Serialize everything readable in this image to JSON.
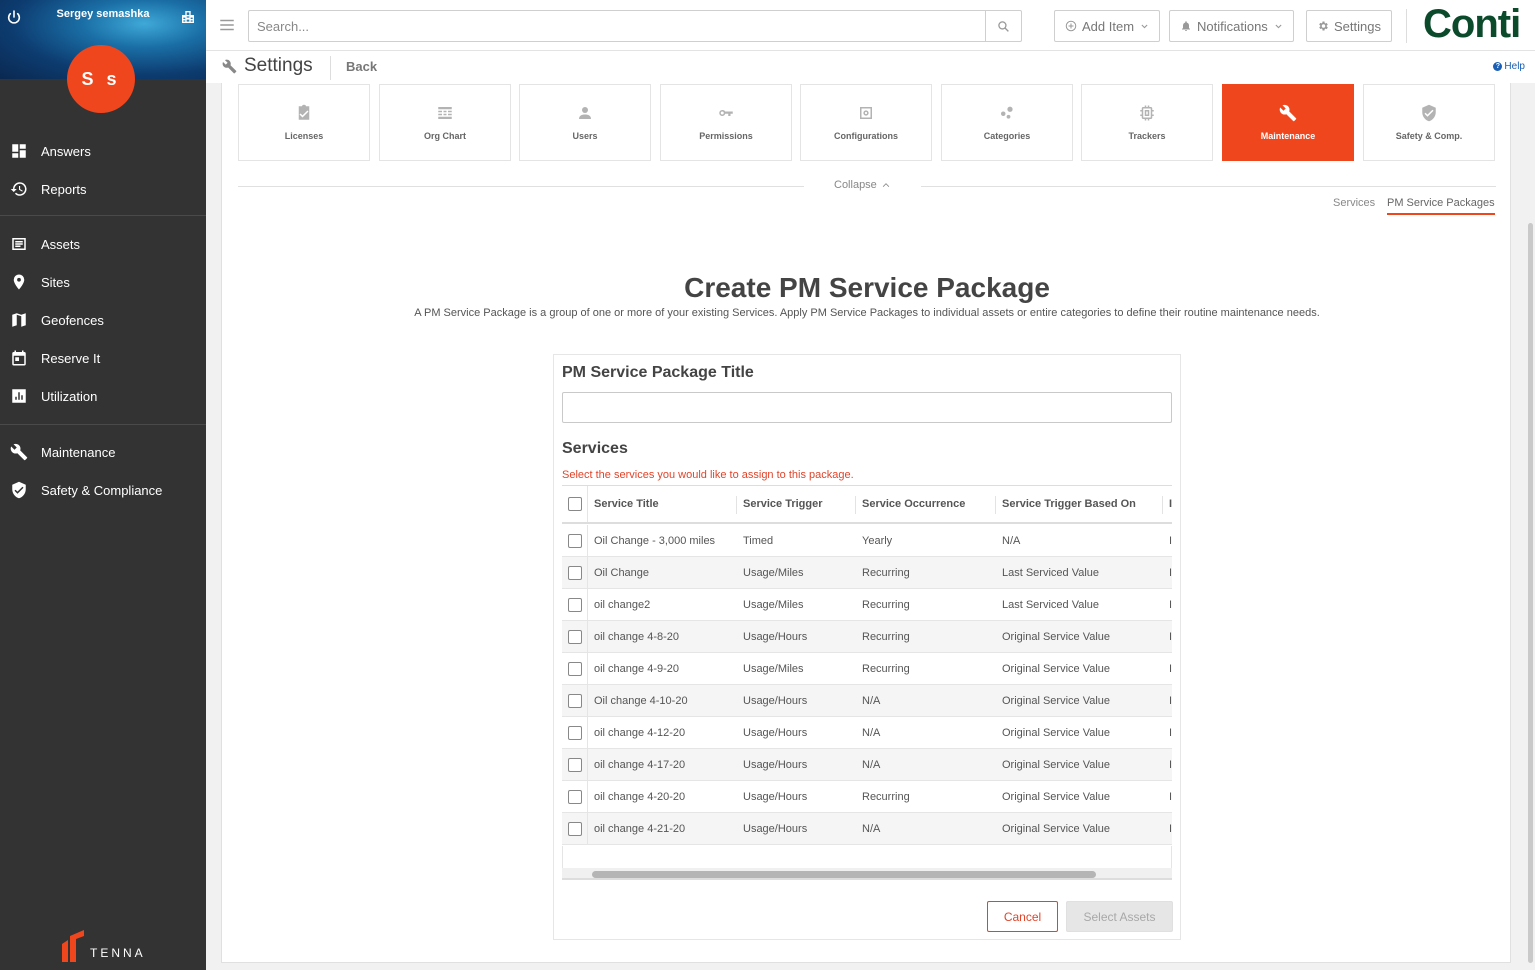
{
  "sidebar": {
    "username": "Sergey semashka",
    "avatar_initials": "S s",
    "items": [
      {
        "label": "Answers",
        "icon": "dashboard-icon"
      },
      {
        "label": "Reports",
        "icon": "history-icon"
      },
      {
        "label": "Assets",
        "icon": "list-icon"
      },
      {
        "label": "Sites",
        "icon": "map-pin-icon"
      },
      {
        "label": "Geofences",
        "icon": "map-icon"
      },
      {
        "label": "Reserve It",
        "icon": "calendar-icon"
      },
      {
        "label": "Utilization",
        "icon": "bar-chart-icon"
      },
      {
        "label": "Maintenance",
        "icon": "wrench-icon"
      },
      {
        "label": "Safety & Compliance",
        "icon": "shield-check-icon"
      }
    ],
    "logo_text": "TENNA"
  },
  "topbar": {
    "search_placeholder": "Search...",
    "add_item_label": "Add Item",
    "notifications_label": "Notifications",
    "settings_label": "Settings",
    "brand_text": "Conti"
  },
  "subheader": {
    "title": "Settings",
    "back_label": "Back",
    "help_label": "Help"
  },
  "tiles": [
    {
      "label": "Licenses",
      "icon": "clipboard-check-icon",
      "active": false
    },
    {
      "label": "Org Chart",
      "icon": "org-chart-icon",
      "active": false
    },
    {
      "label": "Users",
      "icon": "user-icon",
      "active": false
    },
    {
      "label": "Permissions",
      "icon": "key-icon",
      "active": false
    },
    {
      "label": "Configurations",
      "icon": "configuration-icon",
      "active": false
    },
    {
      "label": "Categories",
      "icon": "categories-icon",
      "active": false
    },
    {
      "label": "Trackers",
      "icon": "chip-icon",
      "active": false
    },
    {
      "label": "Maintenance",
      "icon": "wrench-icon",
      "active": true
    },
    {
      "label": "Safety & Comp.",
      "icon": "shield-check-icon",
      "active": false
    }
  ],
  "collapse_label": "Collapse",
  "tabs": {
    "services": "Services",
    "pm_packages": "PM Service Packages"
  },
  "page": {
    "title": "Create PM Service Package",
    "description": "A PM Service Package is a group of one or more of your existing Services. Apply PM Service Packages to individual assets or entire categories to define their routine maintenance needs."
  },
  "form": {
    "title_label": "PM Service Package Title",
    "title_value": "",
    "services_label": "Services",
    "services_hint": "Select the services you would like to assign to this package.",
    "columns": [
      "Service Title",
      "Service Trigger",
      "Service Occurrence",
      "Service Trigger Based On"
    ],
    "rows": [
      [
        "Oil Change - 3,000 miles",
        "Timed",
        "Yearly",
        "N/A"
      ],
      [
        "Oil Change",
        "Usage/Miles",
        "Recurring",
        "Last Serviced Value"
      ],
      [
        "oil change2",
        "Usage/Miles",
        "Recurring",
        "Last Serviced Value"
      ],
      [
        "oil change 4-8-20",
        "Usage/Hours",
        "Recurring",
        "Original Service Value"
      ],
      [
        "oil change 4-9-20",
        "Usage/Miles",
        "Recurring",
        "Original Service Value"
      ],
      [
        "Oil change 4-10-20",
        "Usage/Hours",
        "N/A",
        "Original Service Value"
      ],
      [
        "oil change 4-12-20",
        "Usage/Hours",
        "N/A",
        "Original Service Value"
      ],
      [
        "oil change 4-17-20",
        "Usage/Hours",
        "N/A",
        "Original Service Value"
      ],
      [
        "oil change 4-20-20",
        "Usage/Hours",
        "Recurring",
        "Original Service Value"
      ],
      [
        "oil change 4-21-20",
        "Usage/Hours",
        "N/A",
        "Original Service Value"
      ]
    ],
    "cancel_label": "Cancel",
    "select_assets_label": "Select Assets"
  },
  "colors": {
    "accent": "#f0461e",
    "sidebar_bg": "#333333",
    "brand": "#0c4a2c"
  }
}
